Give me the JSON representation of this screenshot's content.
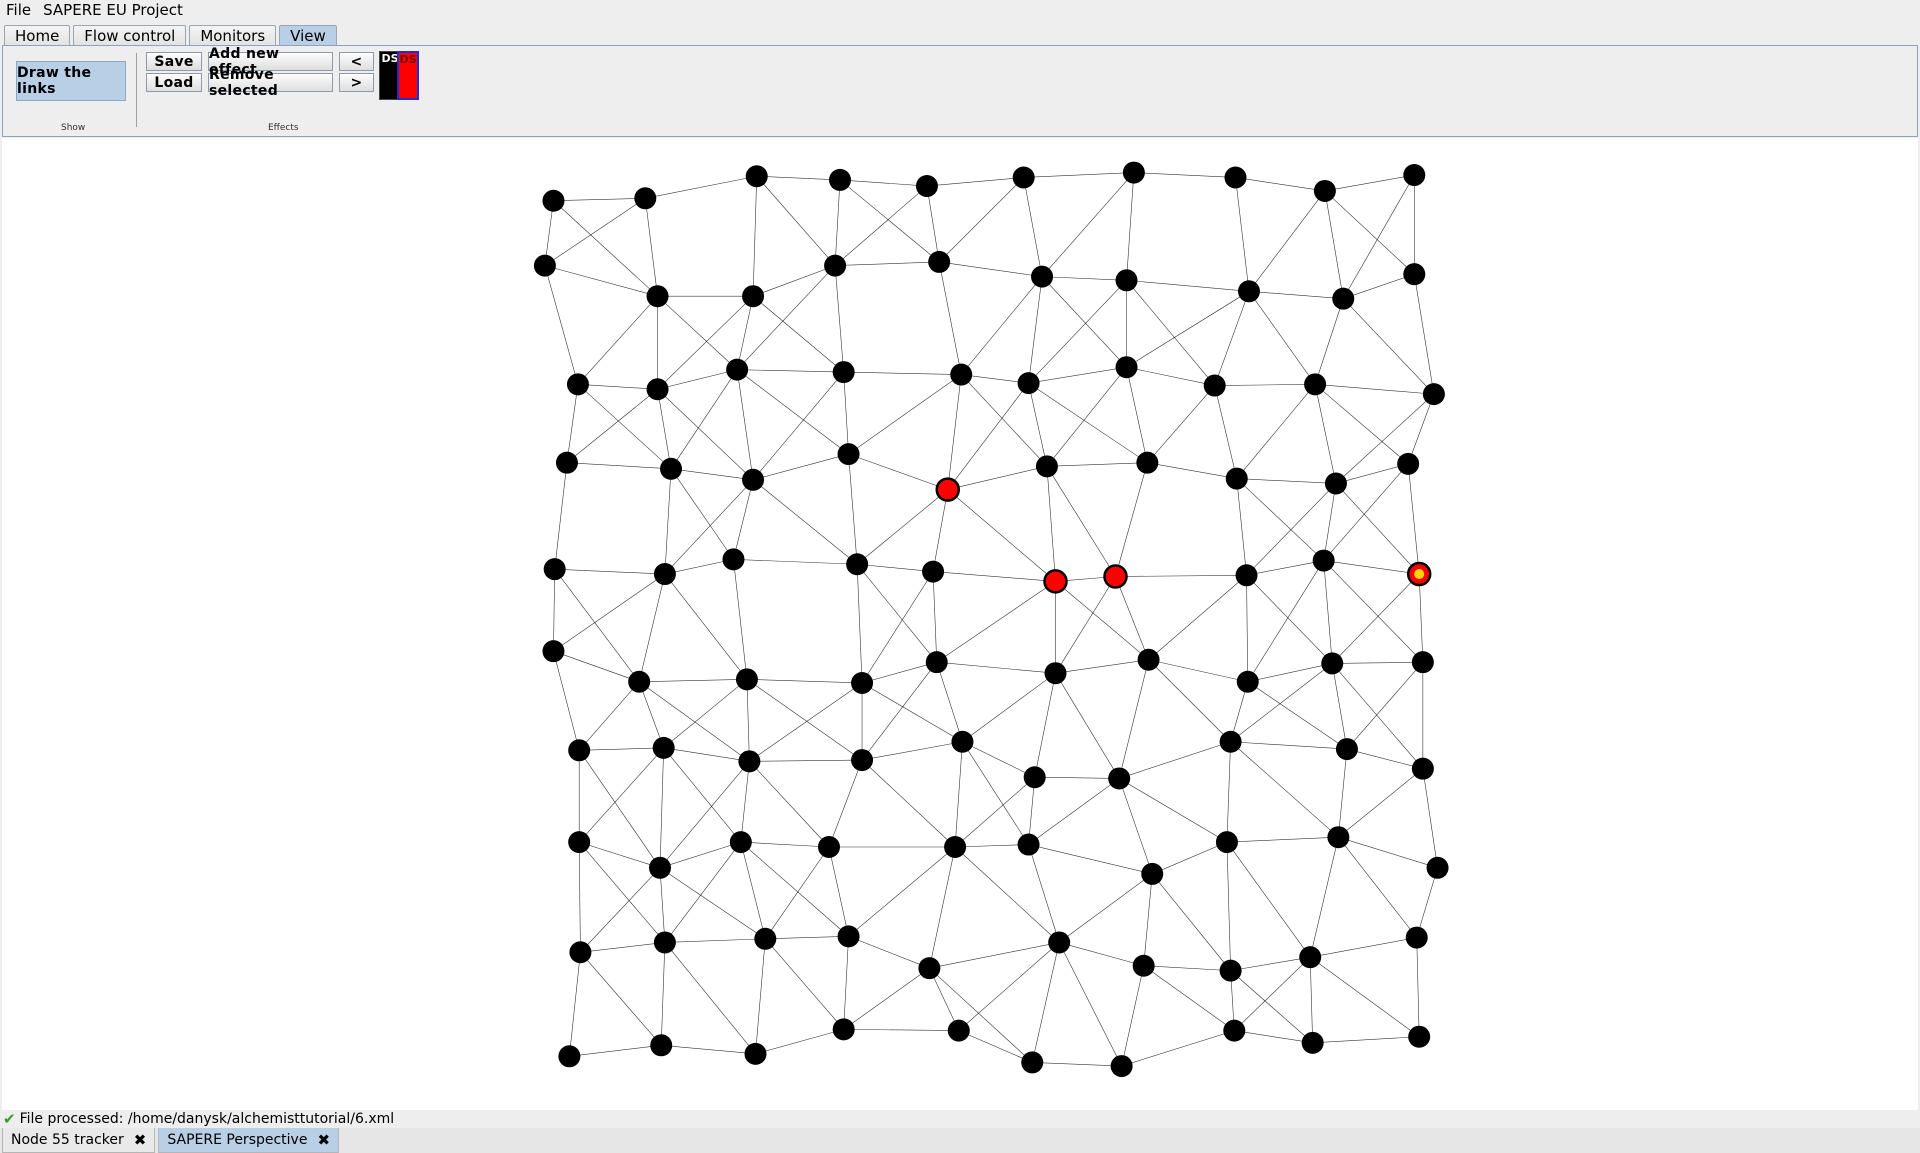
{
  "menu": [
    "File",
    "SAPERE EU Project"
  ],
  "tabs": [
    "Home",
    "Flow control",
    "Monitors",
    "View"
  ],
  "active_tab": "View",
  "ribbon": {
    "draw_links": "Draw the links",
    "show_group": "Show",
    "save": "Save",
    "load": "Load",
    "add_effect": "Add new effect",
    "remove_selected": "Remove selected",
    "prev": "<",
    "next": ">",
    "effects_group": "Effects",
    "swatch1": "DS",
    "swatch2": "DS",
    "swatch1_color": "#000000",
    "swatch2_color": "#ff0000"
  },
  "status": {
    "icon": "check-icon",
    "text": "File processed: /home/danysk/alchemisttutorial/6.xml"
  },
  "bottom_tabs": [
    "Node 55 tracker",
    "SAPERE Perspective"
  ],
  "colors": {
    "node": "#000000",
    "node_active": "#ff0000",
    "node_source": "#ffd800",
    "link": "#000000",
    "accent": "#b8cfe5"
  },
  "node_states": {
    "red_nodes": 3,
    "source_nodes": 1
  }
}
